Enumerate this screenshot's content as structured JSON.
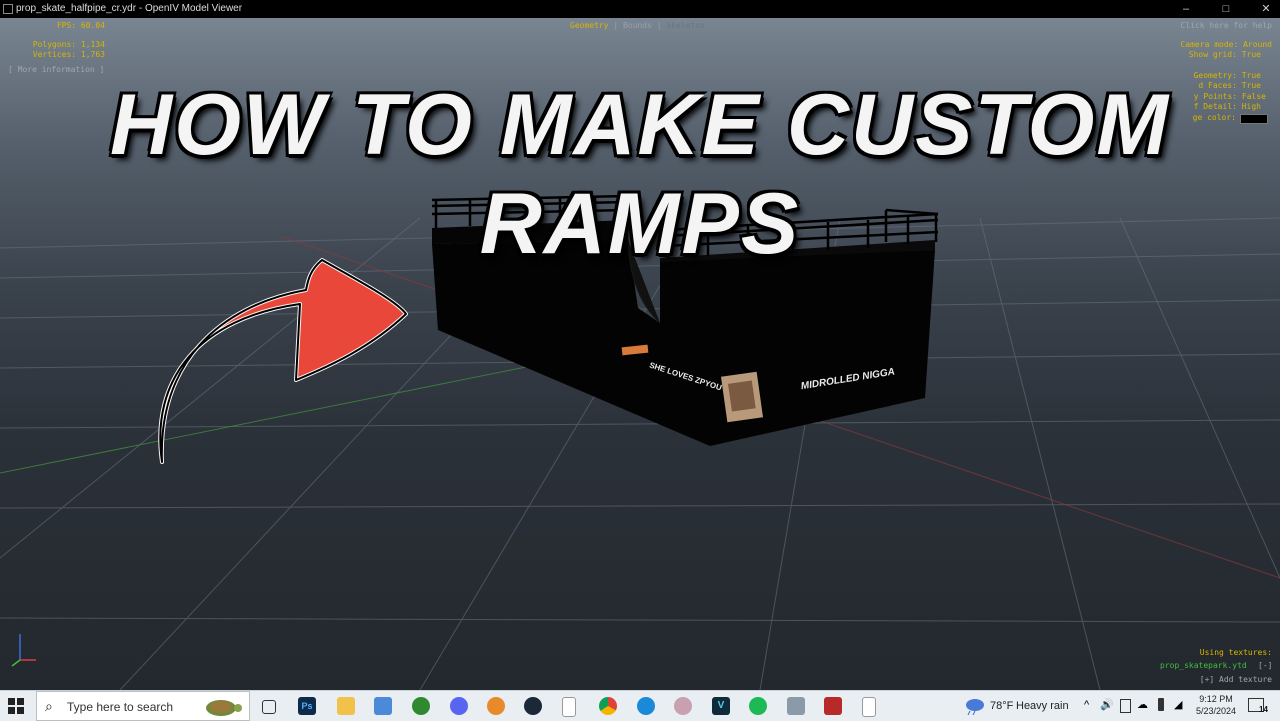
{
  "window": {
    "title": "prop_skate_halfpipe_cr.ydr - OpenIV Model Viewer",
    "controls": [
      "–",
      "□",
      "✕"
    ]
  },
  "hud": {
    "fps": "FPS: 60.04",
    "polygons": "Polygons: 1,134",
    "vertices": "Vertices: 1,763",
    "more_info": "[ More information ]",
    "tabs": {
      "geometry": "Geometry",
      "sep1": " | ",
      "bounds": "Bounds",
      "sep2": " | ",
      "skeleton": "Skeleton"
    },
    "help": "Click here for help",
    "camera_mode": "Camera mode: Around",
    "show_grid": "Show grid: True",
    "geometry": "Geometry: True",
    "faces": "d Faces: True",
    "points": "y Points: False",
    "detail": "f Detail: High",
    "edge_color": "ge color:",
    "using_textures": "Using textures:",
    "texture_file": "prop_skatepark.ytd",
    "texture_toggle": "[-]",
    "add_texture": "[+] Add texture"
  },
  "thumbnail": {
    "headline": "HOW TO MAKE CUSTOM RAMPS",
    "sticker_left": "SHE LOVES ZPYOU",
    "sticker_right": "MIDROLLED NIGGA"
  },
  "colors": {
    "arrow": "#e8473a",
    "hud_yellow": "#d8b500",
    "ramp": "#030303",
    "taskbar": "#e9eef3"
  },
  "taskbar": {
    "search_placeholder": "Type here to search",
    "apps": [
      "task-view-icon",
      "photoshop-icon",
      "file-explorer-icon",
      "store-icon",
      "xbox-icon",
      "discord-icon",
      "fl-studio-icon",
      "steam-icon",
      "file-icon",
      "chrome-icon",
      "edge-icon",
      "app-icon",
      "vegas-icon",
      "spotify-icon",
      "printer-icon",
      "game-icon",
      "document-icon"
    ],
    "weather_temp": "78°F",
    "weather_desc": "Heavy rain",
    "time": "9:12 PM",
    "date": "5/23/2024",
    "notification_count": "14"
  }
}
